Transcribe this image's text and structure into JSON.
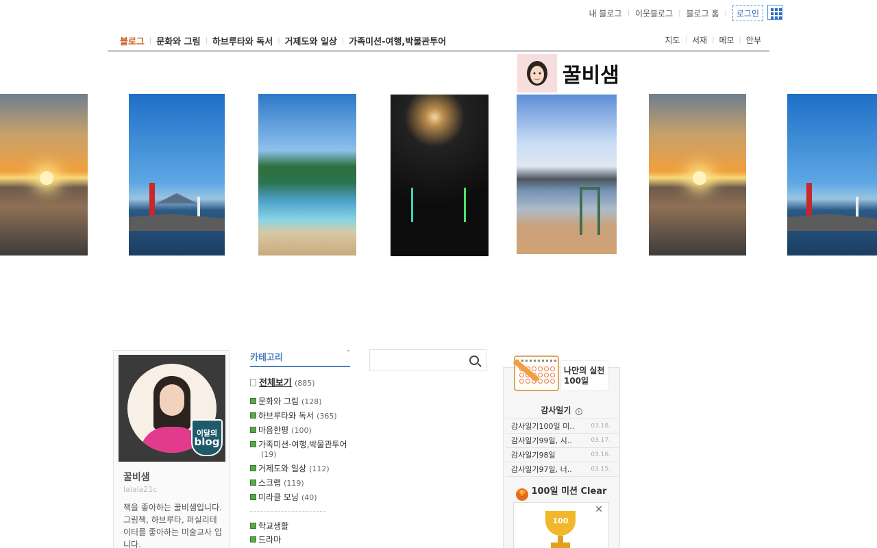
{
  "util": {
    "my_blog": "내 블로그",
    "neighbor_blog": "이웃블로그",
    "blog_home": "블로그 홈",
    "login": "로그인"
  },
  "nav": {
    "left": [
      "블로그",
      "문화와 그림",
      "하브루타와 독서",
      "거제도와 일상",
      "가족미션-여행,박물관투어"
    ],
    "right": [
      "지도",
      "서재",
      "메모",
      "안부"
    ]
  },
  "header": {
    "blog_title": "꿀비샘"
  },
  "profile": {
    "name": "꿀비샘",
    "id": "lalala21c",
    "badge_top": "이달의",
    "badge_bottom": "blog",
    "desc": "책을 좋아하는 꿀비샘입니다. 그림책, 하브루타, 퍼실리테이터를 좋아하는 미술교사 입니다."
  },
  "category": {
    "title": "카테고리",
    "all_label": "전체보기",
    "all_count": "(885)",
    "items": [
      {
        "label": "문화와 그림",
        "count": "(128)"
      },
      {
        "label": "하브루타와 독서",
        "count": "(365)"
      },
      {
        "label": "마음한평",
        "count": "(100)"
      },
      {
        "label": "가족미션-여행,박물관투어",
        "count": "(19)"
      },
      {
        "label": "거제도와 일상",
        "count": "(112)"
      },
      {
        "label": " 스크랩",
        "count": "(119)"
      },
      {
        "label": "미라클 모닝",
        "count": "(40)"
      }
    ],
    "extra": [
      "학교생활",
      "드라마"
    ]
  },
  "search": {
    "placeholder": ""
  },
  "widget": {
    "title_line1": "나만의 실천",
    "title_line2": "100일",
    "section": "감사일기",
    "list": [
      {
        "title": "감사일기100일 미..",
        "date": "03.18."
      },
      {
        "title": "감사일기99일, 시..",
        "date": "03.17."
      },
      {
        "title": "감사일기98일",
        "date": "03.16."
      },
      {
        "title": "감사일기97일, 너..",
        "date": "03.15."
      }
    ],
    "clear": "100일 미션 Clear",
    "cup_label": "100"
  },
  "colors": {
    "accent": "#c95f1c",
    "link": "#4a7fbf"
  }
}
